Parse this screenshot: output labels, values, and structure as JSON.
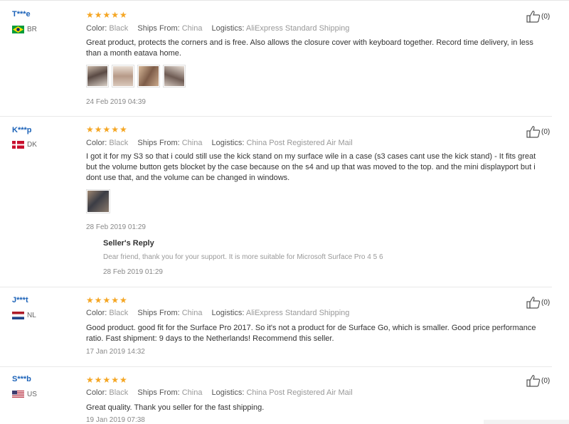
{
  "labels": {
    "color": "Color:",
    "ships_from": "Ships From:",
    "logistics": "Logistics:",
    "stars": "★★★★★"
  },
  "reviews": [
    {
      "user": "T***e",
      "country": "BR",
      "flag_icon": "brazil-flag-icon",
      "color": "Black",
      "ships_from": "China",
      "logistics": "AliExpress Standard Shipping",
      "text": "Great product, protects the corners and is free. Also allows the closure cover with keyboard together. Record time delivery, in less than a month eatava home.",
      "date": "24 Feb 2019 04:39",
      "likes": "(0)"
    },
    {
      "user": "K***p",
      "country": "DK",
      "flag_icon": "denmark-flag-icon",
      "color": "Black",
      "ships_from": "China",
      "logistics": "China Post Registered Air Mail",
      "text": "I got it for my S3 so that i could still use the kick stand on my surface wile in a case (s3 cases cant use the kick stand) - It fits great but the volume button gets blocket by the case because on the s4 and up that was moved to the top. and the mini displayport but i dont use that, and the volume can be changed in windows.",
      "date": "28 Feb 2019 01:29",
      "likes": "(0)",
      "seller_reply": {
        "title": "Seller's Reply",
        "text": "Dear friend, thank you for your support. It is more suitable for Microsoft Surface Pro 4 5 6",
        "date": "28 Feb 2019 01:29"
      }
    },
    {
      "user": "J***t",
      "country": "NL",
      "flag_icon": "netherlands-flag-icon",
      "color": "Black",
      "ships_from": "China",
      "logistics": "AliExpress Standard Shipping",
      "text": "Good product. good fit for the Surface Pro 2017. So it's not a product for de Surface Go, which is smaller. Good price performance ratio. Fast shipment: 9 days to the Netherlands! Recommend this seller.",
      "date": "17 Jan 2019 14:32",
      "likes": "(0)"
    },
    {
      "user": "S***b",
      "country": "US",
      "flag_icon": "usa-flag-icon",
      "color": "Black",
      "ships_from": "China",
      "logistics": "China Post Registered Air Mail",
      "text": "Great quality. Thank you seller for the fast shipping.",
      "date": "19 Jan 2019 07:38",
      "likes": "(0)"
    }
  ]
}
